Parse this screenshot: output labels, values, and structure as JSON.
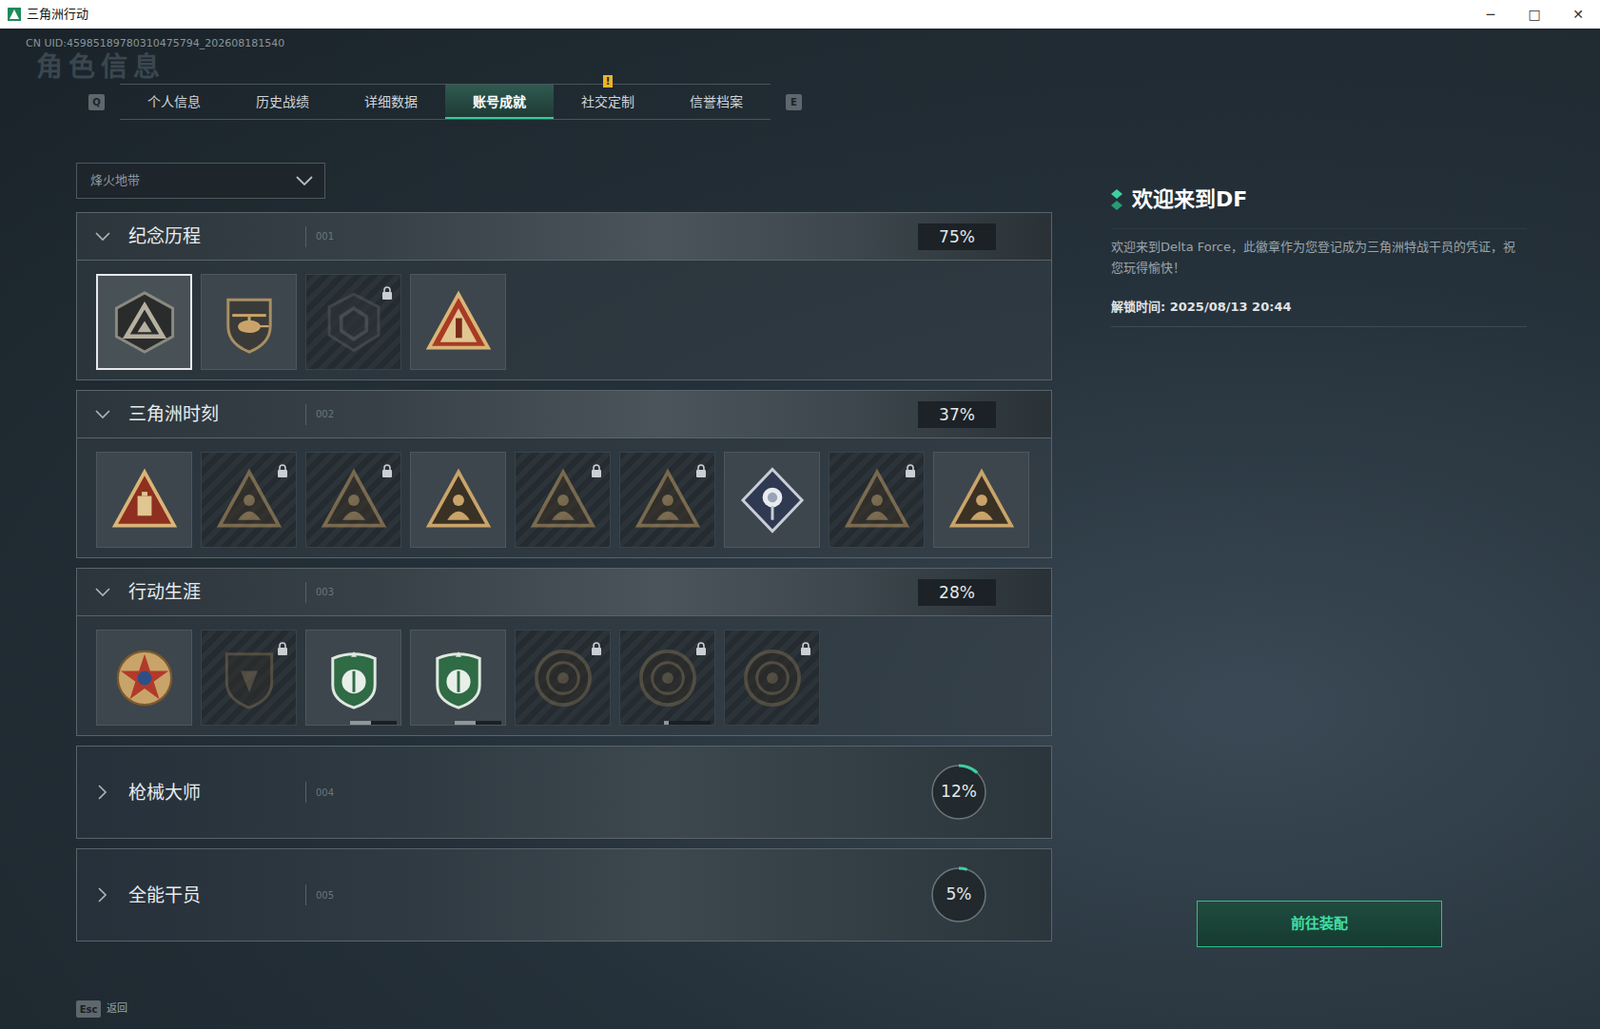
{
  "window": {
    "title": "三角洲行动",
    "controls": [
      "─",
      "□",
      "✕"
    ]
  },
  "uid": "CN UID:45985189780310475794_202608181540",
  "watermark": "角色信息",
  "tabs": {
    "prev_key": "Q",
    "next_key": "E",
    "items": [
      {
        "label": "个人信息",
        "selected": false
      },
      {
        "label": "历史战绩",
        "selected": false
      },
      {
        "label": "详细数据",
        "selected": false
      },
      {
        "label": "账号成就",
        "selected": true
      },
      {
        "label": "社交定制",
        "selected": false,
        "alert": "!"
      },
      {
        "label": "信誉档案",
        "selected": false
      }
    ]
  },
  "mode_select": {
    "value": "烽火地带"
  },
  "sections": [
    {
      "title": "纪念历程",
      "code": "001",
      "percent": "75%",
      "expanded": true,
      "badges": [
        {
          "kind": "delta",
          "locked": false,
          "selected": true
        },
        {
          "kind": "heli",
          "locked": false,
          "selected": false
        },
        {
          "kind": "hex",
          "locked": true,
          "selected": false
        },
        {
          "kind": "rank",
          "locked": false,
          "selected": false
        }
      ]
    },
    {
      "title": "三角洲时刻",
      "code": "002",
      "percent": "37%",
      "expanded": true,
      "badges": [
        {
          "kind": "triangle-red",
          "locked": false,
          "selected": false
        },
        {
          "kind": "triangle",
          "locked": true,
          "selected": false
        },
        {
          "kind": "triangle",
          "locked": true,
          "selected": false
        },
        {
          "kind": "triangle",
          "locked": false,
          "selected": false
        },
        {
          "kind": "triangle",
          "locked": true,
          "selected": false
        },
        {
          "kind": "triangle",
          "locked": true,
          "selected": false
        },
        {
          "kind": "rose",
          "locked": false,
          "selected": false
        },
        {
          "kind": "triangle",
          "locked": true,
          "selected": false
        },
        {
          "kind": "triangle",
          "locked": false,
          "selected": false
        }
      ]
    },
    {
      "title": "行动生涯",
      "code": "003",
      "percent": "28%",
      "expanded": true,
      "badges": [
        {
          "kind": "star",
          "locked": false,
          "selected": false
        },
        {
          "kind": "shield",
          "locked": true,
          "selected": false
        },
        {
          "kind": "green",
          "locked": false,
          "selected": false,
          "level": 0.45
        },
        {
          "kind": "green",
          "locked": false,
          "selected": false,
          "level": 0.45
        },
        {
          "kind": "round",
          "locked": true,
          "selected": false
        },
        {
          "kind": "round",
          "locked": true,
          "selected": false,
          "level": 0.1
        },
        {
          "kind": "round",
          "locked": true,
          "selected": false
        }
      ]
    },
    {
      "title": "枪械大师",
      "code": "004",
      "percent": "12%",
      "expanded": false,
      "level": 0.12
    },
    {
      "title": "全能干员",
      "code": "005",
      "percent": "5%",
      "expanded": false,
      "level": 0.05
    }
  ],
  "detail": {
    "title": "欢迎来到DF",
    "description": "欢迎来到Delta Force，此徽章作为您登记成为三角洲特战干员的凭证，祝您玩得愉快！",
    "unlock_time": "解锁时间: 2025/08/13 20:44",
    "button": "前往装配"
  },
  "footer": {
    "key": "Esc",
    "label": "返回"
  }
}
